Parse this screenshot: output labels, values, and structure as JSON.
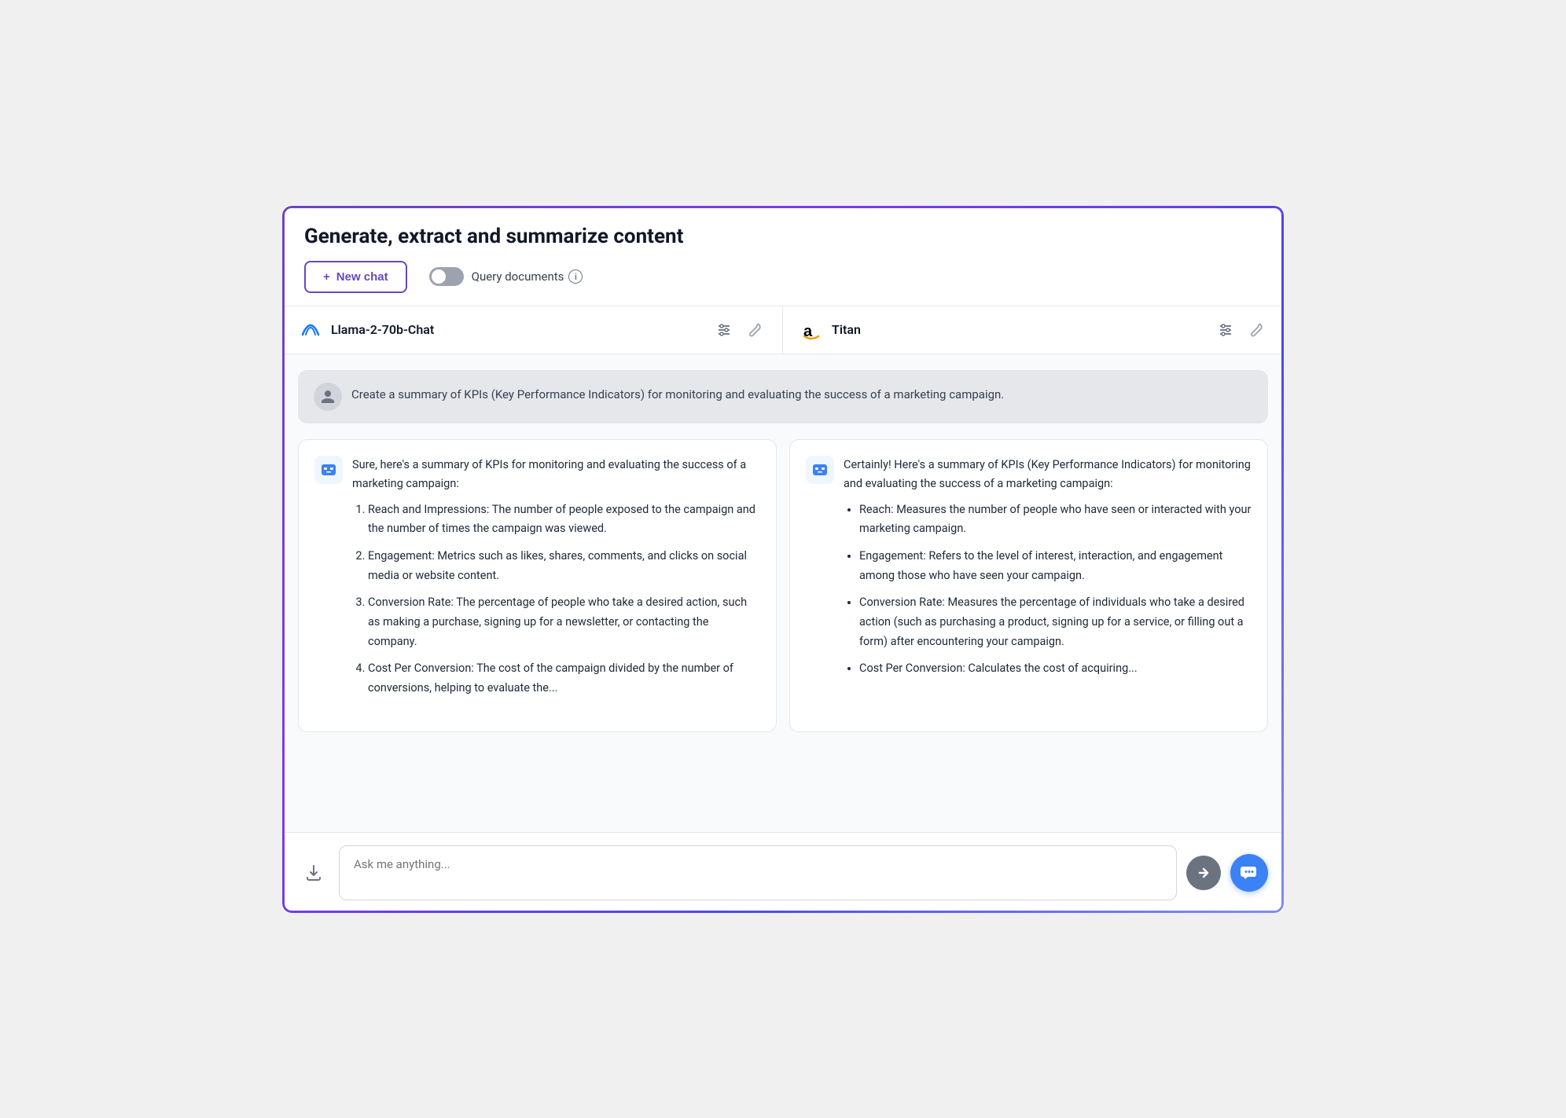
{
  "page": {
    "title": "Generate, extract and summarize content"
  },
  "toolbar": {
    "new_chat_label": "New chat",
    "new_chat_plus": "+",
    "query_docs_label": "Query documents",
    "info_symbol": "i"
  },
  "models": [
    {
      "id": "llama",
      "icon_type": "meta",
      "icon_label": "∞",
      "name": "Llama-2-70b-Chat"
    },
    {
      "id": "titan",
      "icon_type": "amazon",
      "icon_label": "a",
      "name": "Titan"
    }
  ],
  "user_message": "Create a summary of KPIs (Key Performance Indicators) for monitoring and evaluating the success of a marketing campaign.",
  "responses": [
    {
      "intro": "Sure, here's a summary of KPIs for monitoring and evaluating the success of a marketing campaign:",
      "list_type": "ol",
      "items": [
        "Reach and Impressions: The number of people exposed to the campaign and the number of times the campaign was viewed.",
        "Engagement: Metrics such as likes, shares, comments, and clicks on social media or website content.",
        "Conversion Rate: The percentage of people who take a desired action, such as making a purchase, signing up for a newsletter, or contacting the company.",
        "Cost Per Conversion: The cost of the campaign divided by the number of conversions, helping to evaluate the..."
      ]
    },
    {
      "intro": "Certainly! Here's a summary of KPIs (Key Performance Indicators) for monitoring and evaluating the success of a marketing campaign:",
      "list_type": "ul",
      "items": [
        "Reach: Measures the number of people who have seen or interacted with your marketing campaign.",
        "Engagement: Refers to the level of interest, interaction, and engagement among those who have seen your campaign.",
        "Conversion Rate: Measures the percentage of individuals who take a desired action (such as purchasing a product, signing up for a service, or filling out a form) after encountering your campaign.",
        "Cost Per Conversion: Calculates the cost of acquiring..."
      ]
    }
  ],
  "input": {
    "placeholder": "Ask me anything..."
  }
}
